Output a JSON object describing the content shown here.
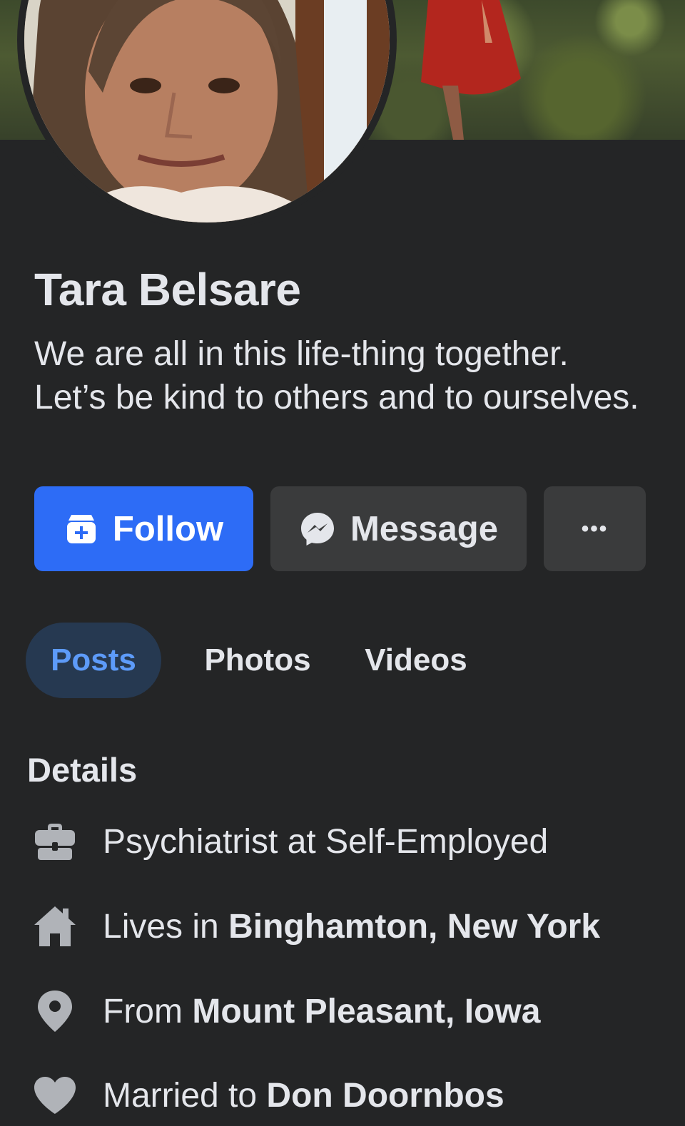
{
  "profile": {
    "name": "Tara Belsare",
    "bio": "We are all in this life-thing together. Let’s be kind to others and to ourselves."
  },
  "actions": {
    "follow_label": "Follow",
    "message_label": "Message",
    "more_label": "•••"
  },
  "tabs": [
    {
      "label": "Posts",
      "active": true
    },
    {
      "label": "Photos",
      "active": false
    },
    {
      "label": "Videos",
      "active": false
    }
  ],
  "details": {
    "title": "Details",
    "items": [
      {
        "icon": "briefcase-icon",
        "prefix": "Psychiatrist at Self-Employed",
        "emphasis": ""
      },
      {
        "icon": "home-icon",
        "prefix": "Lives in ",
        "emphasis": "Binghamton, New York"
      },
      {
        "icon": "location-pin-icon",
        "prefix": "From ",
        "emphasis": "Mount Pleasant, Iowa"
      },
      {
        "icon": "heart-icon",
        "prefix": "Married to ",
        "emphasis": "Don Doornbos"
      }
    ]
  },
  "colors": {
    "background": "#242526",
    "primary": "#2d6cf6",
    "secondary_button": "#3a3b3c",
    "active_tab_bg": "#263951",
    "active_tab_text": "#5d9bf9",
    "text": "#e4e6eb",
    "icon": "#b0b3b8"
  }
}
